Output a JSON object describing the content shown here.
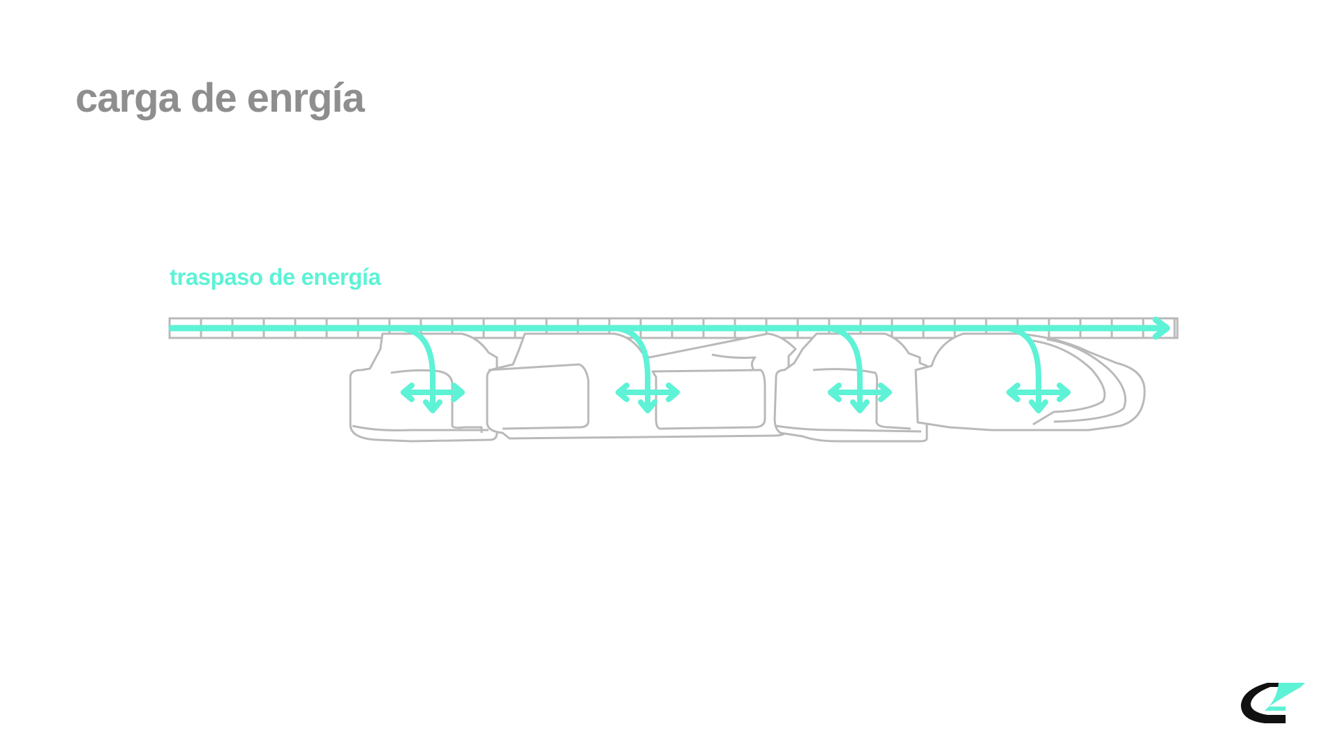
{
  "slide": {
    "title": "carga de enrgía"
  },
  "diagram": {
    "label": "traspaso de energía",
    "colors": {
      "accent": "#5ef2d6",
      "outline": "#b9b9b9",
      "title": "#8e8e8e",
      "logo_dark": "#111111"
    },
    "icons": [
      "energy-transfer-arrow-icon",
      "distribution-arrows-icon",
      "car-outline-icon",
      "brand-logo-icon"
    ]
  }
}
